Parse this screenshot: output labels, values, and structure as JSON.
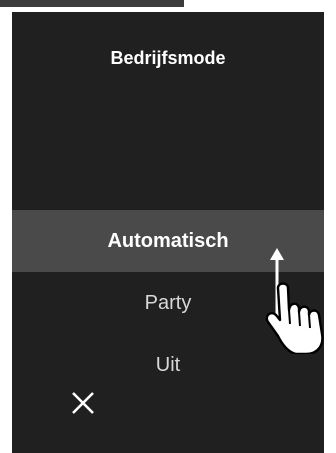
{
  "header": {
    "title": "Bedrijfsmode"
  },
  "options": [
    {
      "label": "Automatisch",
      "selected": true
    },
    {
      "label": "Party",
      "selected": false
    },
    {
      "label": "Uit",
      "selected": false
    }
  ],
  "icons": {
    "close": "close-icon",
    "gesture": "swipe-vertical-hand-icon"
  },
  "colors": {
    "background": "#202020",
    "selected_row": "#4a4a4a",
    "text": "#ffffff",
    "text_dim": "#d8d8d8"
  }
}
